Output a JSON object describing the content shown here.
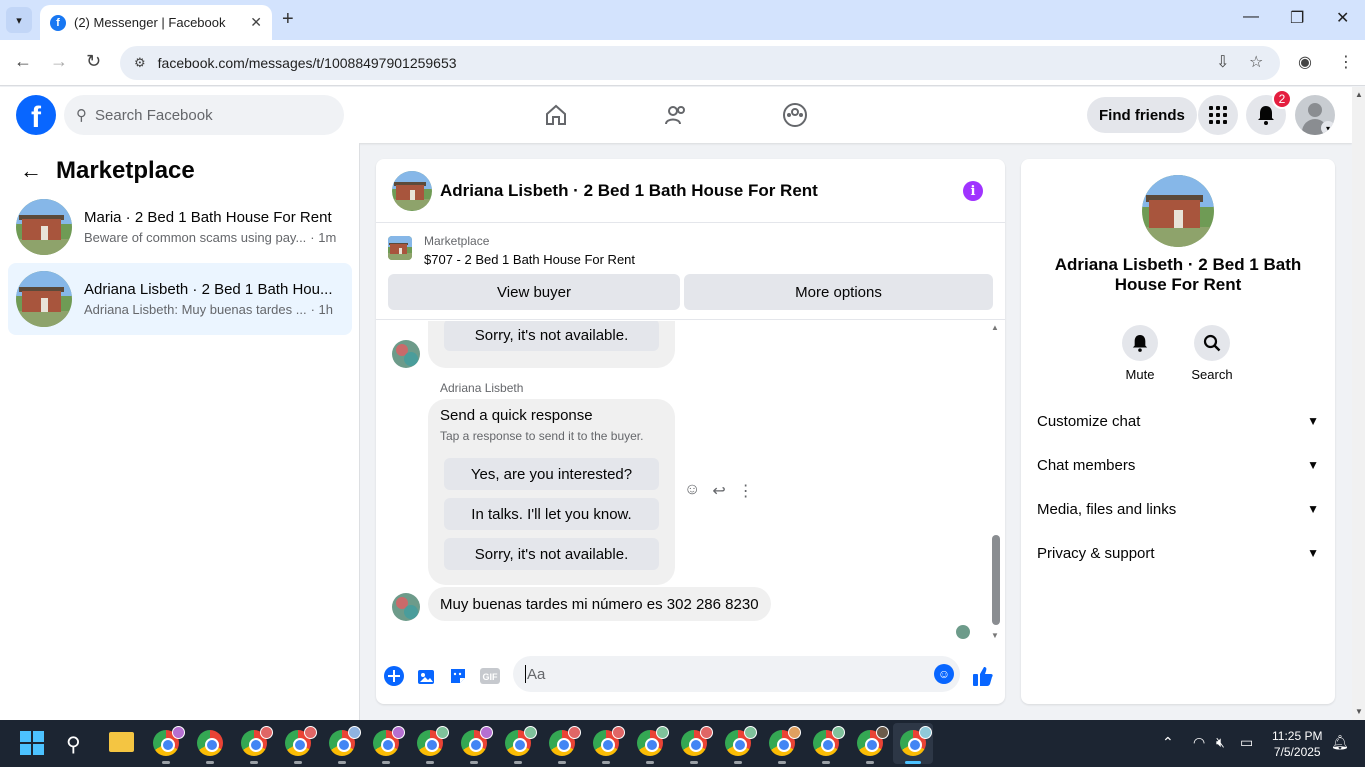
{
  "browser": {
    "tab_title": "(2) Messenger | Facebook",
    "url": "facebook.com/messages/t/10088497901259653",
    "new_tab_label": "+"
  },
  "fb_header": {
    "search_placeholder": "Search Facebook",
    "find_friends_label": "Find friends",
    "notification_count": "2",
    "logo_letter": "f"
  },
  "sidebar": {
    "title": "Marketplace",
    "conversations": [
      {
        "name": "Maria · 2 Bed 1 Bath House For Rent",
        "preview": "Beware of common scams using pay...",
        "time": "· 1m",
        "active": false
      },
      {
        "name": "Adriana Lisbeth · 2 Bed 1 Bath Hou...",
        "preview": "Adriana Lisbeth: Muy buenas tardes ...",
        "time": "· 1h",
        "active": true
      }
    ]
  },
  "chat": {
    "title": "Adriana Lisbeth · 2 Bed 1 Bath House For Rent",
    "listing_label": "Marketplace",
    "listing_price": "$707 - 2 Bed 1 Bath House For Rent",
    "view_buyer_label": "View buyer",
    "more_options_label": "More options",
    "top_partial_reply": "Sorry, it's not available.",
    "sender_name": "Adriana Lisbeth",
    "quick_response": {
      "title": "Send a quick response",
      "subtitle": "Tap a response to send it to the buyer.",
      "options": [
        "Yes, are you interested?",
        "In talks. I'll let you know.",
        "Sorry, it's not available."
      ]
    },
    "last_message": "Muy buenas tardes mi número es 302 286 8230",
    "composer_placeholder": "Aa"
  },
  "details": {
    "name": "Adriana Lisbeth · 2 Bed 1 Bath House For Rent",
    "mute_label": "Mute",
    "search_label": "Search",
    "sections": [
      "Customize chat",
      "Chat members",
      "Media, files and links",
      "Privacy & support"
    ]
  },
  "taskbar": {
    "time": "11:25 PM",
    "date": "7/5/2025"
  },
  "colors": {
    "fb_blue": "#0866ff",
    "active_conv_bg": "#ebf5ff",
    "info_purple": "#a033ff",
    "notif_red": "#e41e3f"
  }
}
